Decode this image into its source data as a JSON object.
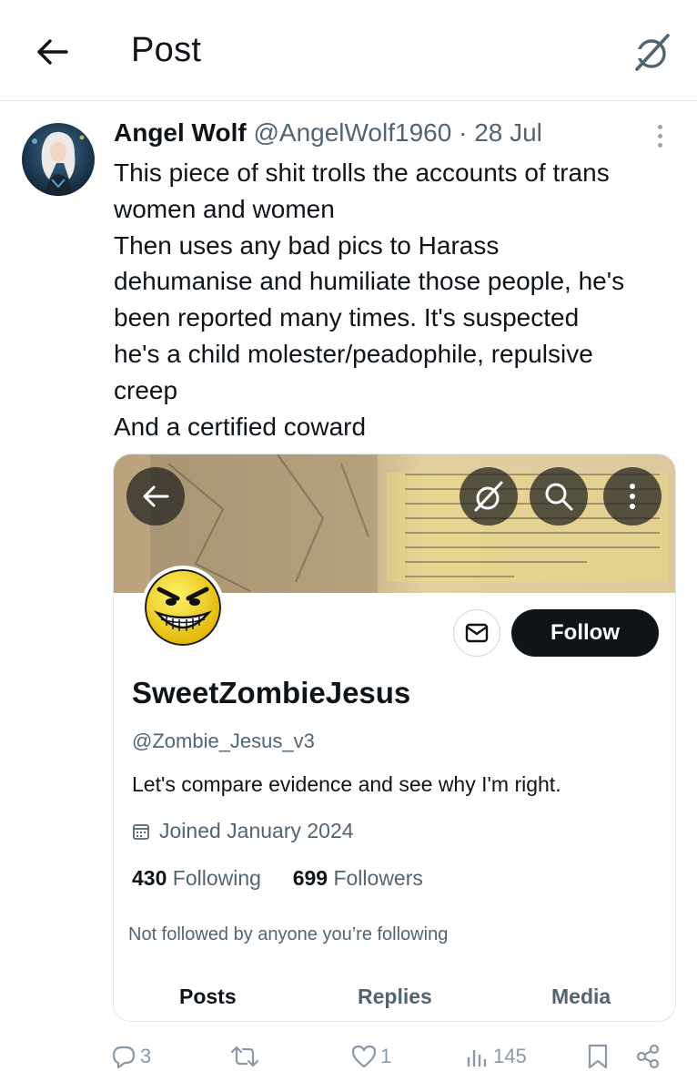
{
  "header": {
    "title": "Post"
  },
  "tweet": {
    "author_name": "Angel Wolf",
    "author_handle": "@AngelWolf1960",
    "separator": "·",
    "date": "28 Jul",
    "text_lines": [
      "This piece of shit trolls the accounts of trans",
      "women and women",
      "Then uses any bad pics to Harass",
      "dehumanise and humiliate those people, he's",
      "been reported many times. It's suspected",
      "he's a child molester/peadophile, repulsive",
      "creep",
      "And a certified coward"
    ]
  },
  "embedded_profile": {
    "display_name": "SweetZombieJesus",
    "handle": "@Zombie_Jesus_v3",
    "bio": "Let's compare evidence and see why I'm right.",
    "joined": "Joined January 2024",
    "following_count": "430",
    "following_label": "Following",
    "followers_count": "699",
    "followers_label": "Followers",
    "not_followed_text": "Not followed by anyone you’re following",
    "follow_label": "Follow",
    "tabs": [
      "Posts",
      "Replies",
      "Media"
    ]
  },
  "actions": {
    "replies": "3",
    "reposts": "",
    "likes": "1",
    "views": "145"
  },
  "colors": {
    "text_primary": "#0f1419",
    "text_secondary": "#536471",
    "icon_gray": "#8b98a5",
    "follow_button_bg": "#0f1419"
  },
  "icons": {
    "back": "arrow-left-icon",
    "grok": "grok-icon",
    "more": "more-vertical-icon",
    "message": "envelope-icon",
    "calendar": "calendar-icon",
    "reply": "reply-icon",
    "repost": "repost-icon",
    "like": "heart-icon",
    "views": "views-icon",
    "bookmark": "bookmark-icon",
    "share": "share-icon"
  }
}
